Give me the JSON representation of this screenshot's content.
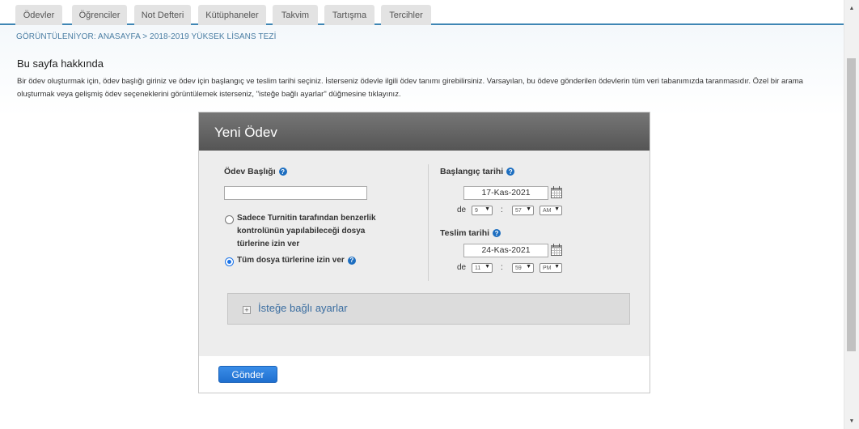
{
  "tabs": [
    {
      "label": "Ödevler"
    },
    {
      "label": "Öğrenciler"
    },
    {
      "label": "Not Defteri"
    },
    {
      "label": "Kütüphaneler"
    },
    {
      "label": "Takvim"
    },
    {
      "label": "Tartışma"
    },
    {
      "label": "Tercihler"
    }
  ],
  "breadcrumb": "GÖRÜNTÜLENİYOR: ANASAYFA > 2018-2019 YÜKSEK LİSANS TEZİ",
  "about": {
    "title": "Bu sayfa hakkında",
    "text": "Bir ödev oluşturmak için, ödev başlığı giriniz ve ödev için başlangıç ve teslim tarihi seçiniz. İsterseniz ödevle ilgili ödev tanımı girebilirsiniz. Varsayılan, bu ödeve gönderilen ödevlerin tüm veri tabanımızda taranmasıdır. Özel bir arama oluşturmak veya gelişmiş ödev seçeneklerini görüntülemek isterseniz, \"isteğe bağlı ayarlar\" düğmesine tıklayınız."
  },
  "dialog": {
    "title": "Yeni Ödev",
    "assignment_title_label": "Ödev Başlığı",
    "assignment_title_value": "",
    "radio_option_1_lines": [
      "Sadece Turnitin tarafından benzerlik",
      "kontrolünün yapılabileceği dosya",
      "türlerine izin ver"
    ],
    "radio_option_2": "Tüm dosya türlerine izin ver",
    "selected_option": 2,
    "start": {
      "label": "Başlangıç tarihi",
      "date": "17-Kas-2021",
      "de": "de",
      "hour": "9",
      "minute": "57",
      "ampm": "AM"
    },
    "due": {
      "label": "Teslim tarihi",
      "date": "24-Kas-2021",
      "de": "de",
      "hour": "11",
      "minute": "59",
      "ampm": "PM"
    },
    "colon": ":",
    "optional_settings": "İsteğe bağlı ayarlar",
    "submit_label": "Gönder"
  },
  "icons": {
    "help": "question-circle-icon",
    "calendar": "calendar-icon",
    "expand": "plus-box-icon",
    "scroll_up": "triangle-up-icon",
    "scroll_down": "triangle-down-icon"
  },
  "colors": {
    "accent": "#3f86b4",
    "link": "#4a7da3",
    "button": "#1f6fcf",
    "header": "#606060"
  }
}
